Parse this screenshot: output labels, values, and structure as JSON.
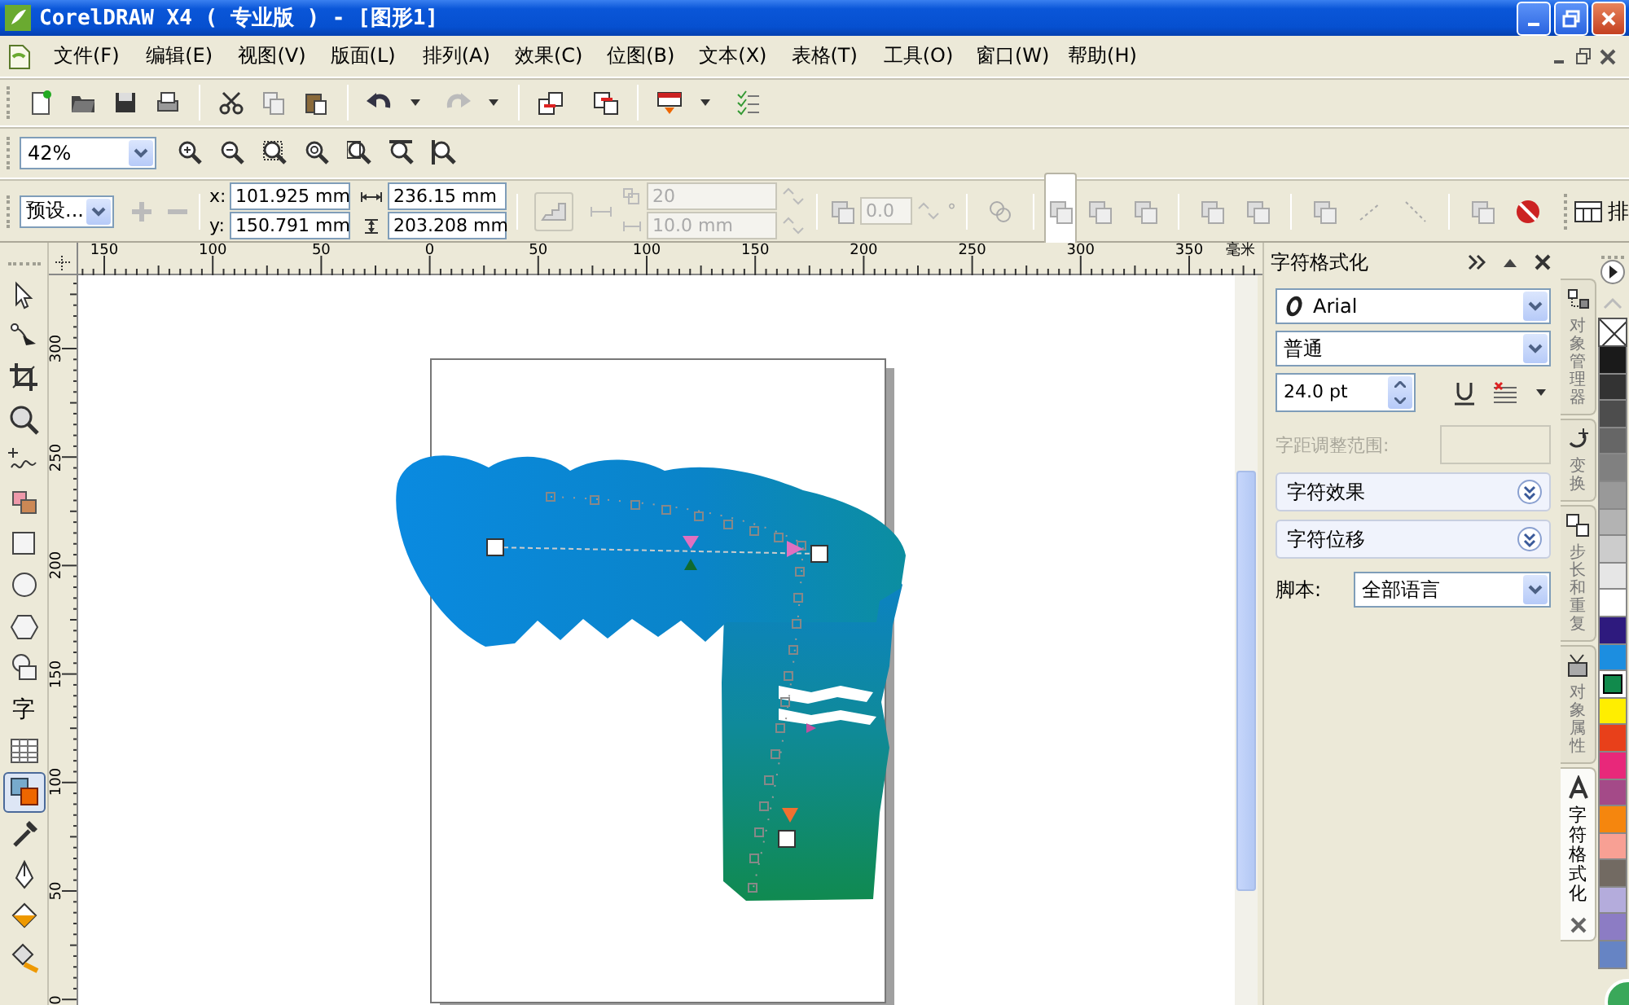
{
  "window": {
    "title": "CorelDRAW X4 ( 专业版 ) - [图形1]"
  },
  "menu": [
    {
      "label": "文件(F)"
    },
    {
      "label": "编辑(E)"
    },
    {
      "label": "视图(V)"
    },
    {
      "label": "版面(L)"
    },
    {
      "label": "排列(A)"
    },
    {
      "label": "效果(C)"
    },
    {
      "label": "位图(B)"
    },
    {
      "label": "文本(X)"
    },
    {
      "label": "表格(T)"
    },
    {
      "label": "工具(O)"
    },
    {
      "label": "窗口(W)"
    },
    {
      "label": "帮助(H)"
    }
  ],
  "zoom_level": "42%",
  "property_bar": {
    "preset": "预设...",
    "x_label": "x:",
    "x": "101.925 mm",
    "y_label": "y:",
    "y": "150.791 mm",
    "width": "236.15 mm",
    "height": "203.208 mm",
    "steps": "20",
    "spacing": "10.0 mm",
    "rotation": "0.0",
    "degree": "°",
    "cut_label": "排"
  },
  "toolbox": [
    {
      "kind": "pick",
      "selected": false
    },
    {
      "kind": "shape",
      "selected": false
    },
    {
      "kind": "crop",
      "selected": false
    },
    {
      "kind": "zoom",
      "selected": false
    },
    {
      "kind": "freehand",
      "selected": false
    },
    {
      "kind": "smartfill",
      "selected": false
    },
    {
      "kind": "rectangle",
      "selected": false
    },
    {
      "kind": "ellipse",
      "selected": false
    },
    {
      "kind": "polygon",
      "selected": false
    },
    {
      "kind": "basicshapes",
      "selected": false
    },
    {
      "kind": "text",
      "label": "字",
      "selected": false
    },
    {
      "kind": "table",
      "selected": false
    },
    {
      "kind": "blend",
      "selected": true
    },
    {
      "kind": "eyedropper",
      "selected": false
    },
    {
      "kind": "outline",
      "selected": false
    },
    {
      "kind": "fill",
      "selected": false
    },
    {
      "kind": "interactivefill",
      "selected": false
    }
  ],
  "rulers": {
    "horizontal": [
      "150",
      "100",
      "50",
      "0",
      "50",
      "100",
      "150",
      "200",
      "250",
      "300",
      "350"
    ],
    "unit": "毫米",
    "vertical": [
      "300",
      "250",
      "200",
      "150",
      "100",
      "50",
      "0"
    ]
  },
  "docker": {
    "title": "字符格式化",
    "font": "Arial",
    "style": "普通",
    "size": "24.0 pt",
    "kerning_label": "字距调整范围:",
    "sections": [
      {
        "label": "字符效果",
        "expanded": false
      },
      {
        "label": "字符位移",
        "expanded": false
      }
    ],
    "script_label": "脚本:",
    "script": "全部语言"
  },
  "docker_tabs": [
    {
      "kind": "objects",
      "label": "对象管理器",
      "selected": false
    },
    {
      "kind": "transform",
      "label": "变换",
      "selected": false
    },
    {
      "kind": "repeat",
      "label": "步长和重复",
      "selected": false
    },
    {
      "kind": "properties",
      "label": "对象属性",
      "selected": false
    },
    {
      "kind": "character",
      "label": "字符格式化",
      "selected": true
    }
  ],
  "palette": [
    {
      "kind": "none"
    },
    {
      "kind": "swatch",
      "color": "#1a1a1a",
      "selected": false
    },
    {
      "kind": "swatch",
      "color": "#333333",
      "selected": false
    },
    {
      "kind": "swatch",
      "color": "#4d4d4d",
      "selected": false
    },
    {
      "kind": "swatch",
      "color": "#666666",
      "selected": false
    },
    {
      "kind": "swatch",
      "color": "#808080",
      "selected": false
    },
    {
      "kind": "swatch",
      "color": "#999999",
      "selected": false
    },
    {
      "kind": "swatch",
      "color": "#b3b3b3",
      "selected": false
    },
    {
      "kind": "swatch",
      "color": "#cccccc",
      "selected": false
    },
    {
      "kind": "swatch",
      "color": "#e6e6e6",
      "selected": false
    },
    {
      "kind": "swatch",
      "color": "#ffffff",
      "selected": false
    },
    {
      "kind": "swatch",
      "color": "#2e1a7e",
      "selected": false
    },
    {
      "kind": "swatch",
      "color": "#1c8ee0",
      "selected": false
    },
    {
      "kind": "swatch",
      "color": "#118a4c",
      "selected": true
    },
    {
      "kind": "swatch",
      "color": "#ffee00",
      "selected": false
    },
    {
      "kind": "swatch",
      "color": "#e8401a",
      "selected": false
    },
    {
      "kind": "swatch",
      "color": "#e8287a",
      "selected": false
    },
    {
      "kind": "swatch",
      "color": "#a44a88",
      "selected": false
    },
    {
      "kind": "swatch",
      "color": "#f5860e",
      "selected": false
    },
    {
      "kind": "swatch",
      "color": "#f8a094",
      "selected": false
    },
    {
      "kind": "swatch",
      "color": "#726a62",
      "selected": false
    },
    {
      "kind": "swatch",
      "color": "#b4acdc",
      "selected": false
    },
    {
      "kind": "swatch",
      "color": "#8c7cc4",
      "selected": false
    },
    {
      "kind": "swatch",
      "color": "#6684c4",
      "selected": false
    }
  ]
}
